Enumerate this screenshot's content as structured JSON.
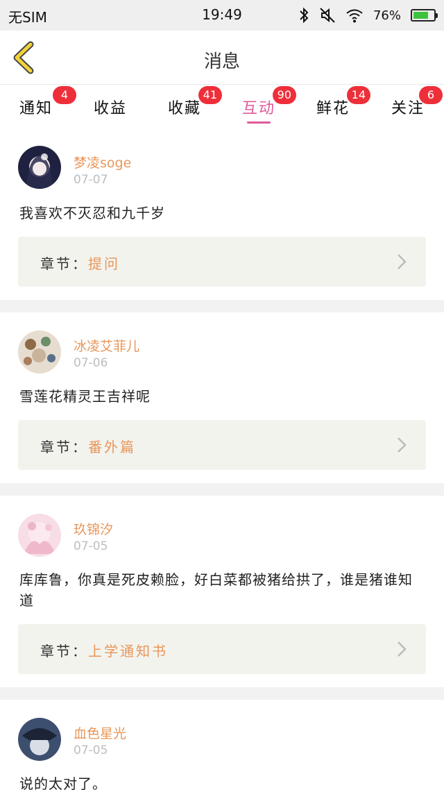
{
  "status_bar": {
    "carrier": "无SIM",
    "time": "19:49",
    "battery": "76%",
    "battery_level": 0.76
  },
  "header": {
    "title": "消息",
    "back_icon": "chevron-left-icon",
    "back_color": "#f2d43a"
  },
  "tabs": [
    {
      "label": "通知",
      "badge": "4"
    },
    {
      "label": "收益",
      "badge": ""
    },
    {
      "label": "收藏",
      "badge": "41"
    },
    {
      "label": "互动",
      "badge": "90",
      "active": true
    },
    {
      "label": "鲜花",
      "badge": "14"
    },
    {
      "label": "关注",
      "badge": "6"
    }
  ],
  "colors": {
    "accent": "#e0599a",
    "badge": "#ee2f3a",
    "username": "#e8965a",
    "card_bg": "#f3f3ee"
  },
  "items": [
    {
      "username": "梦凌soge",
      "date": "07-07",
      "comment": "我喜欢不灭忍和九千岁",
      "chapter_label": "章节：",
      "chapter_name": "提问"
    },
    {
      "username": "冰凌艾菲儿",
      "date": "07-06",
      "comment": "雪莲花精灵王吉祥呢",
      "chapter_label": "章节：",
      "chapter_name": "番外篇"
    },
    {
      "username": "玖锦汐",
      "date": "07-05",
      "comment": "库库鲁，你真是死皮赖脸，好白菜都被猪给拱了，谁是猪谁知道",
      "chapter_label": "章节：",
      "chapter_name": "上学通知书"
    },
    {
      "username": "血色星光",
      "date": "07-05",
      "comment": "说的太对了。"
    }
  ]
}
